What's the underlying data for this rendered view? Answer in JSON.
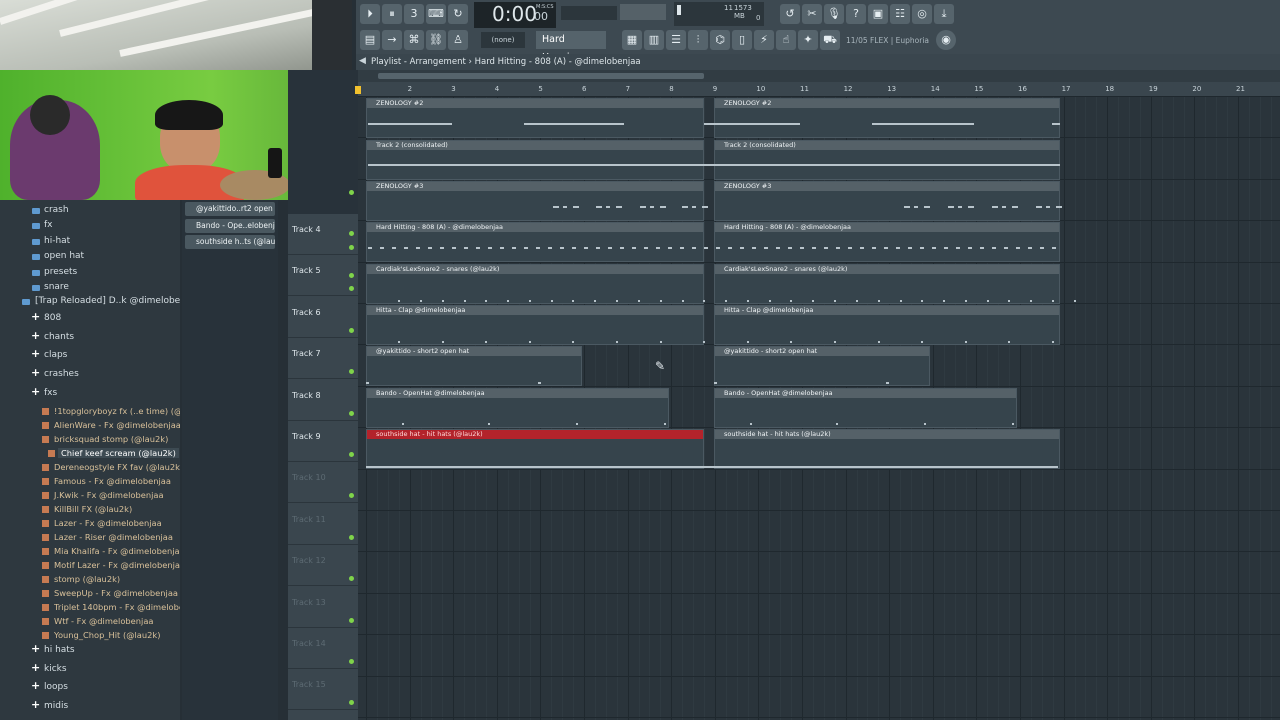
{
  "toolbar": {
    "time": "0:00",
    "time_small": "00",
    "time_unit": "M:S:CS",
    "cpu_label": "11",
    "mem_label": "1573 MB",
    "mem_sub": "0",
    "pattern_none": "(none)",
    "pattern_name": "Hard H..enjaa",
    "news": "11/05  FLEX | Euphoria"
  },
  "playlist": {
    "breadcrumb": "Playlist - Arrangement › Hard Hitting - 808 (A) - @dimelobenjaa",
    "ruler": [
      "2",
      "3",
      "4",
      "5",
      "6",
      "7",
      "8",
      "9",
      "10",
      "11",
      "12",
      "13",
      "14",
      "15",
      "16",
      "17",
      "18",
      "19",
      "20",
      "21"
    ]
  },
  "browser": {
    "folders_top": [
      "crash",
      "fx",
      "hi-hat",
      "open hat",
      "presets",
      "snare"
    ],
    "pack": "[Trap Reloaded] D..k @dimelobenjaa",
    "groups": [
      "808",
      "chants",
      "claps",
      "crashes",
      "fxs"
    ],
    "fx_items": [
      "!1topgloryboyz fx (..e time) (@lau2k)",
      "AlienWare - Fx @dimelobenjaa",
      "bricksquad stomp (@lau2k)",
      "Chief keef scream (@lau2k)",
      "Dereneogstyle FX fav (@lau2k)",
      "Famous - Fx @dimelobenjaa",
      "J.Kwik - Fx @dimelobenjaa",
      "KillBill FX (@lau2k)",
      "Lazer - Fx @dimelobenjaa",
      "Lazer - Riser @dimelobenjaa",
      "Mia Khalifa - Fx @dimelobenjaa",
      "Motif Lazer - Fx @dimelobenjaa",
      "stomp (@lau2k)",
      "SweepUp - Fx @dimelobenjaa",
      "Triplet 140bpm - Fx @dimelobenjaa",
      "Wtf - Fx @dimelobenjaa",
      "Young_Chop_Hit (@lau2k)"
    ],
    "groups_bottom": [
      "hi hats",
      "kicks",
      "loops",
      "midis"
    ]
  },
  "picker": [
    "@yakittido..rt2 open hat",
    "Bando - Ope..elobenjaa",
    "southside h..ts (@lau2k)"
  ],
  "tracks": [
    {
      "name": "Track 4"
    },
    {
      "name": "Track 5"
    },
    {
      "name": "Track 6"
    },
    {
      "name": "Track 7"
    },
    {
      "name": "Track 8"
    },
    {
      "name": "Track 9"
    },
    {
      "name": "Track 10"
    },
    {
      "name": "Track 11"
    },
    {
      "name": "Track 12"
    },
    {
      "name": "Track 13"
    },
    {
      "name": "Track 14"
    },
    {
      "name": "Track 15"
    }
  ],
  "clips": [
    {
      "label": "ZENOLOGY #2"
    },
    {
      "label": "Track 2 (consolidated)"
    },
    {
      "label": "ZENOLOGY #3"
    },
    {
      "label": "Hard Hitting - 808 (A) - @dimelobenjaa"
    },
    {
      "label": "Cardiak'sLexSnare2 - snares (@lau2k)"
    },
    {
      "label": "Hitta - Clap @dimelobenjaa"
    },
    {
      "label": "@yakittido - short2 open hat"
    },
    {
      "label": "Bando - OpenHat  @dimelobenjaa"
    },
    {
      "label": "southside hat - hit hats (@lau2k)"
    }
  ]
}
